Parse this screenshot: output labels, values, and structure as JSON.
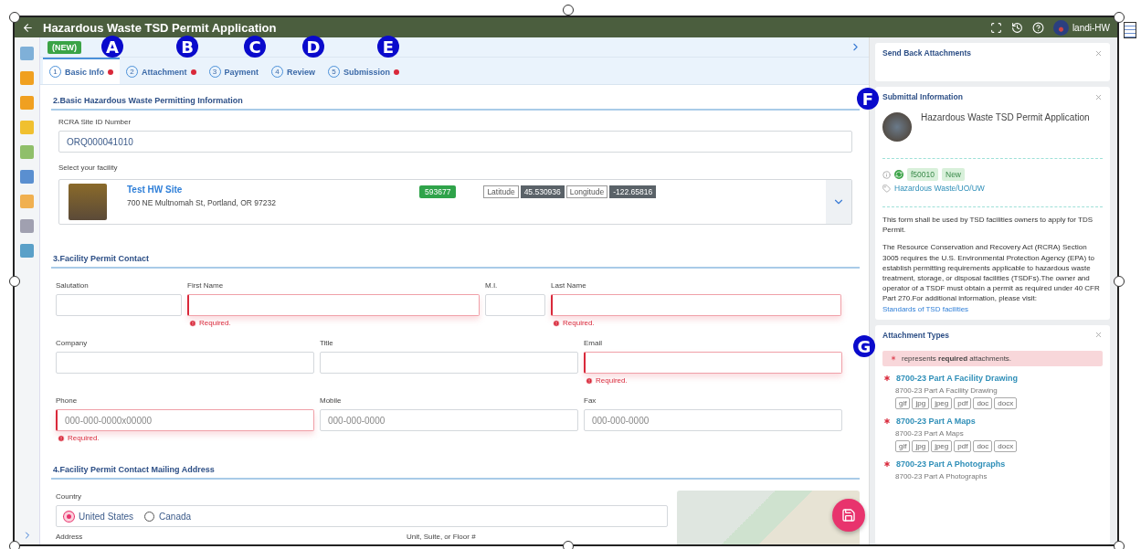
{
  "window": {
    "title": "Hazardous Waste TSD Permit Application",
    "user": "landi-HW"
  },
  "callouts": [
    "A",
    "B",
    "C",
    "D",
    "E",
    "F",
    "G"
  ],
  "status_badge": "(NEW)",
  "steps": [
    {
      "number": "1",
      "label": "Basic Info",
      "error": true,
      "selected": true
    },
    {
      "number": "2",
      "label": "Attachment",
      "error": true,
      "selected": false
    },
    {
      "number": "3",
      "label": "Payment",
      "error": false,
      "selected": false
    },
    {
      "number": "4",
      "label": "Review",
      "error": false,
      "selected": false
    },
    {
      "number": "5",
      "label": "Submission",
      "error": true,
      "selected": false
    }
  ],
  "section_basic": {
    "title": "2.Basic Hazardous Waste Permitting Information",
    "site_id_label": "RCRA Site ID Number",
    "site_id_value": "ORQ000041010",
    "facility_label": "Select your facility",
    "facility": {
      "name": "Test HW Site",
      "address": "700 NE Multnomah St, Portland, OR 97232",
      "id": "593677",
      "latitude_label": "Latitude",
      "latitude": "45.530936",
      "longitude_label": "Longitude",
      "longitude": "-122.65816"
    }
  },
  "section_contact": {
    "title": "3.Facility Permit Contact",
    "rows": [
      [
        {
          "label": "Salutation",
          "error": false
        },
        {
          "label": "First Name",
          "error": true,
          "error_text": "Required."
        },
        {
          "label": "M.I.",
          "error": false
        },
        {
          "label": "Last Name",
          "error": true,
          "error_text": "Required."
        }
      ],
      [
        {
          "label": "Company",
          "error": false
        },
        {
          "label": "Title",
          "error": false
        },
        {
          "label": "Email",
          "error": true,
          "error_text": "Required."
        }
      ],
      [
        {
          "label": "Phone",
          "error": true,
          "error_text": "Required.",
          "placeholder": "000-000-0000x00000"
        },
        {
          "label": "Mobile",
          "error": false,
          "placeholder": "000-000-0000"
        },
        {
          "label": "Fax",
          "error": false,
          "placeholder": "000-000-0000"
        }
      ]
    ]
  },
  "section_address": {
    "title": "4.Facility Permit Contact Mailing Address",
    "country_label": "Country",
    "countries": [
      {
        "label": "United States",
        "selected": true
      },
      {
        "label": "Canada",
        "selected": false
      }
    ],
    "address_label": "Address",
    "unit_label": "Unit, Suite, or Floor #"
  },
  "send_back": {
    "title": "Send Back Attachments"
  },
  "submittal": {
    "title": "Submittal Information",
    "form_name": "Hazardous Waste TSD Permit Application",
    "form_id": "f50010",
    "status": "New",
    "category": "Hazardous Waste/UO/UW",
    "description": "This form shall be used by TSD facilities owners to apply for TDS Permit.",
    "details": "The Resource Conservation and Recovery Act (RCRA) Section 3005 requires the U.S. Environmental Protection Agency (EPA) to establish permitting requirements applicable to hazardous waste treatment, storage, or disposal facilities (TSDFs).The owner and operator of a TSDF must obtain a permit as required under 40 CFR Part 270.For additional information, please visit:",
    "link": "Standards of TSD facilities"
  },
  "attachment_types": {
    "title": "Attachment Types",
    "note": "represents **required** attachments.",
    "items": [
      {
        "name": "8700-23 Part A Facility Drawing",
        "description": "8700-23 Part A Facility Drawing",
        "required": true,
        "extensions": [
          "gif",
          "jpg",
          "jpeg",
          "pdf",
          "doc",
          "docx"
        ]
      },
      {
        "name": "8700-23 Part A Maps",
        "description": "8700-23 Part A Maps",
        "required": true,
        "extensions": [
          "gif",
          "jpg",
          "jpeg",
          "pdf",
          "doc",
          "docx"
        ]
      },
      {
        "name": "8700-23 Part A Photographs",
        "description": "8700-23 Part A Photographs",
        "required": true
      }
    ]
  }
}
